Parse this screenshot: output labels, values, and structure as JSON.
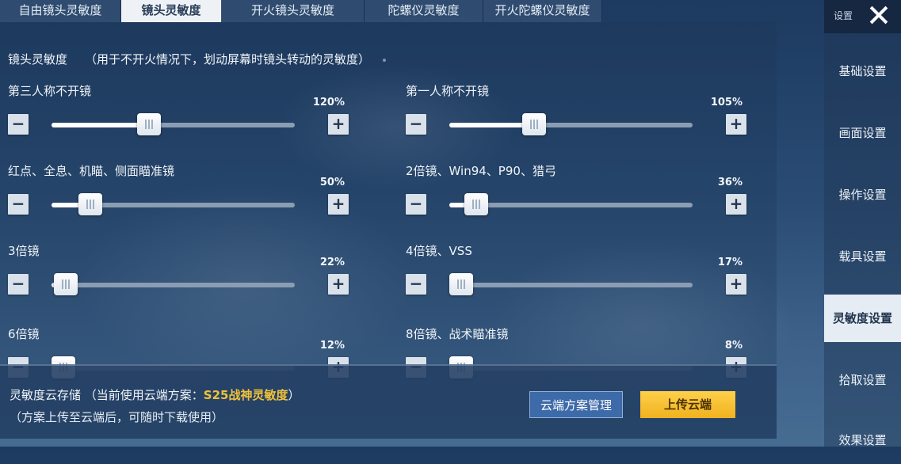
{
  "tabs": [
    {
      "label": "自由镜头灵敏度"
    },
    {
      "label": "镜头灵敏度"
    },
    {
      "label": "开火镜头灵敏度"
    },
    {
      "label": "陀螺仪灵敏度"
    },
    {
      "label": "开火陀螺仪灵敏度"
    }
  ],
  "section": {
    "title": "镜头灵敏度",
    "description": "（用于不开火情况下，划动屏幕时镜头转动的灵敏度）"
  },
  "controls": {
    "minus": "−",
    "plus": "+"
  },
  "sliders": [
    {
      "label": "第三人称不开镜",
      "value_text": "120%",
      "level": 0.4
    },
    {
      "label": "第一人称不开镜",
      "value_text": "105%",
      "level": 0.35
    },
    {
      "label": "红点、全息、机瞄、侧面瞄准镜",
      "value_text": "50%",
      "level": 0.16
    },
    {
      "label": "2倍镜、Win94、P90、猎弓",
      "value_text": "36%",
      "level": 0.11
    },
    {
      "label": "3倍镜",
      "value_text": "22%",
      "level": 0.06
    },
    {
      "label": "4倍镜、VSS",
      "value_text": "17%",
      "level": 0.05
    },
    {
      "label": "6倍镜",
      "value_text": "12%",
      "level": 0.03
    },
    {
      "label": "8倍镜、战术瞄准镜",
      "value_text": "8%",
      "level": 0.02
    }
  ],
  "cloud": {
    "prefix": "灵敏度云存储 （当前使用云端方案：",
    "plan": "S25战神灵敏度",
    "suffix": "）",
    "note": "（方案上传至云端后，可随时下载使用）",
    "manage_label": "云端方案管理",
    "upload_label": "上传云端"
  },
  "sidebar": {
    "header_label": "设置",
    "items": [
      {
        "label": "基础设置"
      },
      {
        "label": "画面设置"
      },
      {
        "label": "操作设置"
      },
      {
        "label": "载具设置"
      },
      {
        "label": "灵敏度设置"
      },
      {
        "label": "拾取设置"
      },
      {
        "label": "效果设置"
      }
    ],
    "active_index": 4
  }
}
